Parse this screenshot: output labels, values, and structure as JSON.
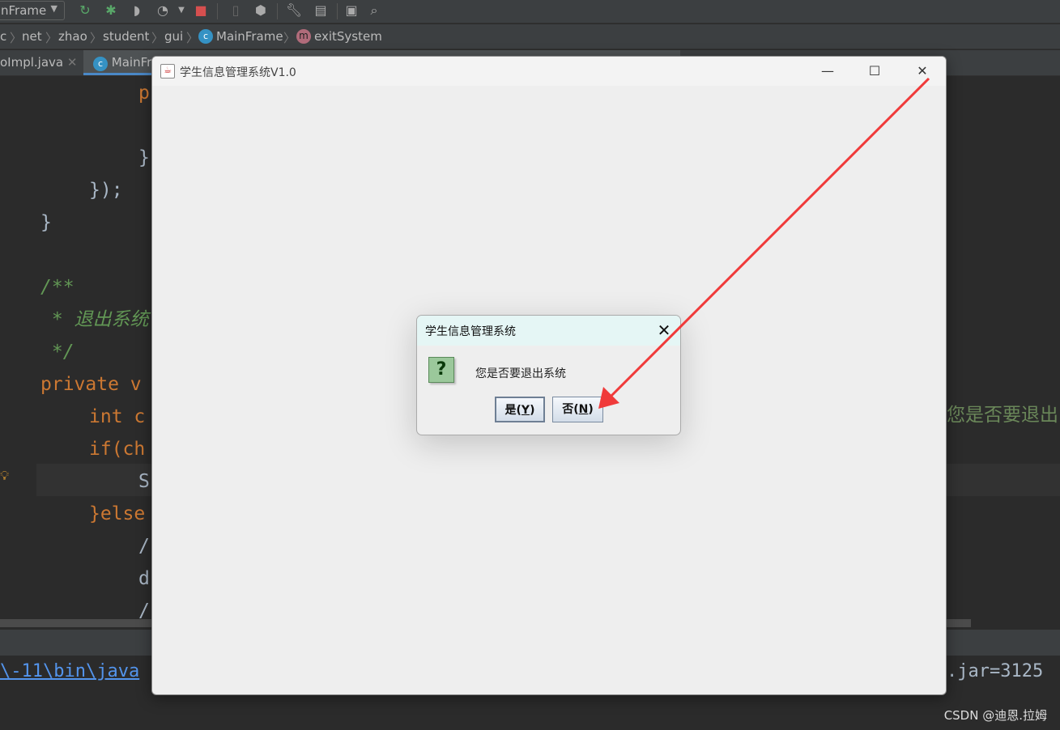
{
  "ide": {
    "run_config": "nFrame",
    "breadcrumbs": [
      "c",
      "net",
      "zhao",
      "student",
      "gui",
      "MainFrame",
      "exitSystem"
    ],
    "tabs": [
      "oImpl.java",
      "MainFr"
    ],
    "code_lines": [
      {
        "text": "p",
        "cls": "kw",
        "indent": 171
      },
      {
        "text": "}",
        "cls": "tx",
        "indent": 171
      },
      {
        "text": "});",
        "cls": "tx",
        "indent": 110
      },
      {
        "text": "}",
        "cls": "tx",
        "indent": 50
      },
      {
        "text": "/**",
        "cls": "cm",
        "indent": 50
      },
      {
        "text": " * 退出系统",
        "cls": "cm",
        "indent": 50
      },
      {
        "text": " */",
        "cls": "cm",
        "indent": 50
      },
      {
        "text": "private v",
        "cls": "kw",
        "indent": 50
      },
      {
        "text": "int c",
        "cls": "kw",
        "indent": 110
      },
      {
        "text": "if(ch",
        "cls": "kw",
        "indent": 110
      },
      {
        "text": "S",
        "cls": "tx",
        "indent": 171
      },
      {
        "text": "}else",
        "cls": "kw",
        "indent": 110
      },
      {
        "text": "/",
        "cls": "tx",
        "indent": 171
      },
      {
        "text": "d",
        "cls": "tx",
        "indent": 171
      },
      {
        "text": "/",
        "cls": "tx",
        "indent": 171
      }
    ],
    "right_string": "您是否要退出",
    "console_left": "\\-11\\bin\\java",
    "console_right": ".jar=3125"
  },
  "window": {
    "title": "学生信息管理系统V1.0",
    "minimize": "—",
    "maximize": "☐",
    "close": "✕"
  },
  "dialog": {
    "title": "学生信息管理系统",
    "message": "您是否要退出系统",
    "yes_label": "是",
    "yes_key": "Y",
    "no_label": "否",
    "no_key": "N",
    "close": "✕"
  },
  "watermark": "CSDN @迪恩.拉姆",
  "colors": {
    "arrow": "#f03a3a",
    "keyword": "#cc7832",
    "comment": "#629755"
  }
}
